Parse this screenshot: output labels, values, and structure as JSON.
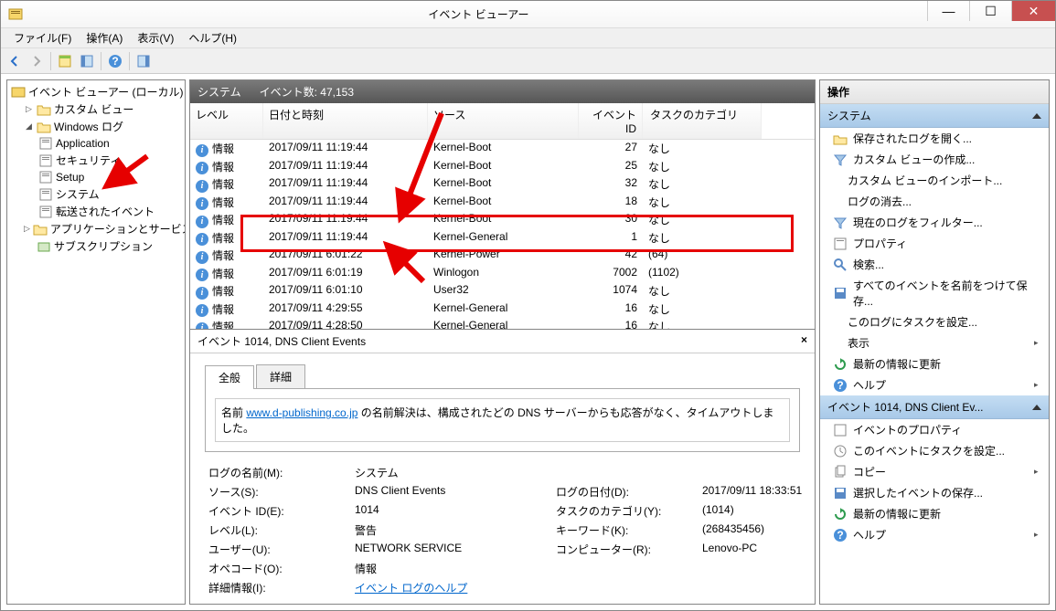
{
  "window": {
    "title": "イベント ビューアー"
  },
  "menu": {
    "file": "ファイル(F)",
    "action": "操作(A)",
    "view": "表示(V)",
    "help": "ヘルプ(H)"
  },
  "tree": {
    "root": "イベント ビューアー (ローカル)",
    "custom_views": "カスタム ビュー",
    "windows_logs": "Windows ログ",
    "application": "Application",
    "security": "セキュリティ",
    "setup": "Setup",
    "system": "システム",
    "forwarded": "転送されたイベント",
    "app_svc_logs": "アプリケーションとサービス ログ",
    "subscriptions": "サブスクリプション"
  },
  "center_header": {
    "title": "システム",
    "count_label": "イベント数: 47,153"
  },
  "columns": {
    "level": "レベル",
    "date": "日付と時刻",
    "source": "ソース",
    "id": "イベント ID",
    "cat": "タスクのカテゴリ"
  },
  "rows": [
    {
      "level": "情報",
      "date": "2017/09/11 11:19:44",
      "source": "Kernel-Boot",
      "id": "27",
      "cat": "なし"
    },
    {
      "level": "情報",
      "date": "2017/09/11 11:19:44",
      "source": "Kernel-Boot",
      "id": "25",
      "cat": "なし"
    },
    {
      "level": "情報",
      "date": "2017/09/11 11:19:44",
      "source": "Kernel-Boot",
      "id": "32",
      "cat": "なし"
    },
    {
      "level": "情報",
      "date": "2017/09/11 11:19:44",
      "source": "Kernel-Boot",
      "id": "18",
      "cat": "なし"
    },
    {
      "level": "情報",
      "date": "2017/09/11 11:19:44",
      "source": "Kernel-Boot",
      "id": "30",
      "cat": "なし"
    },
    {
      "level": "情報",
      "date": "2017/09/11 11:19:44",
      "source": "Kernel-General",
      "id": "1",
      "cat": "なし"
    },
    {
      "level": "情報",
      "date": "2017/09/11 6:01:22",
      "source": "Kernel-Power",
      "id": "42",
      "cat": "(64)"
    },
    {
      "level": "情報",
      "date": "2017/09/11 6:01:19",
      "source": "Winlogon",
      "id": "7002",
      "cat": "(1102)"
    },
    {
      "level": "情報",
      "date": "2017/09/11 6:01:10",
      "source": "User32",
      "id": "1074",
      "cat": "なし"
    },
    {
      "level": "情報",
      "date": "2017/09/11 4:29:55",
      "source": "Kernel-General",
      "id": "16",
      "cat": "なし"
    },
    {
      "level": "情報",
      "date": "2017/09/11 4:28:50",
      "source": "Kernel-General",
      "id": "16",
      "cat": "なし"
    }
  ],
  "detail": {
    "title": "イベント 1014, DNS Client Events",
    "tab_general": "全般",
    "tab_detail": "詳細",
    "msg_prefix": "名前 ",
    "msg_link": "www.d-publishing.co.jp",
    "msg_suffix": " の名前解決は、構成されたどの DNS サーバーからも応答がなく、タイムアウトしました。",
    "labels": {
      "log_name": "ログの名前(M):",
      "log_name_v": "システム",
      "source": "ソース(S):",
      "source_v": "DNS Client Events",
      "logged": "ログの日付(D):",
      "logged_v": "2017/09/11 18:33:51",
      "event_id": "イベント ID(E):",
      "event_id_v": "1014",
      "task_cat": "タスクのカテゴリ(Y):",
      "task_cat_v": "(1014)",
      "level": "レベル(L):",
      "level_v": "警告",
      "keywords": "キーワード(K):",
      "keywords_v": "(268435456)",
      "user": "ユーザー(U):",
      "user_v": "NETWORK SERVICE",
      "computer": "コンピューター(R):",
      "computer_v": "Lenovo-PC",
      "opcode": "オペコード(O):",
      "opcode_v": "情報",
      "more_info": "詳細情報(I):",
      "more_info_link": "イベント ログのヘルプ"
    }
  },
  "actions": {
    "header": "操作",
    "section1": "システム",
    "open_saved_log": "保存されたログを開く...",
    "create_custom_view": "カスタム ビューの作成...",
    "import_custom_view": "カスタム ビューのインポート...",
    "clear_log": "ログの消去...",
    "filter_log": "現在のログをフィルター...",
    "properties": "プロパティ",
    "find": "検索...",
    "save_all": "すべてのイベントを名前をつけて保存...",
    "attach_task_log": "このログにタスクを設定...",
    "view": "表示",
    "refresh": "最新の情報に更新",
    "help": "ヘルプ",
    "section2": "イベント 1014, DNS Client Ev...",
    "event_props": "イベントのプロパティ",
    "attach_task_event": "このイベントにタスクを設定...",
    "copy": "コピー",
    "save_selected": "選択したイベントの保存...",
    "refresh2": "最新の情報に更新",
    "help2": "ヘルプ"
  }
}
